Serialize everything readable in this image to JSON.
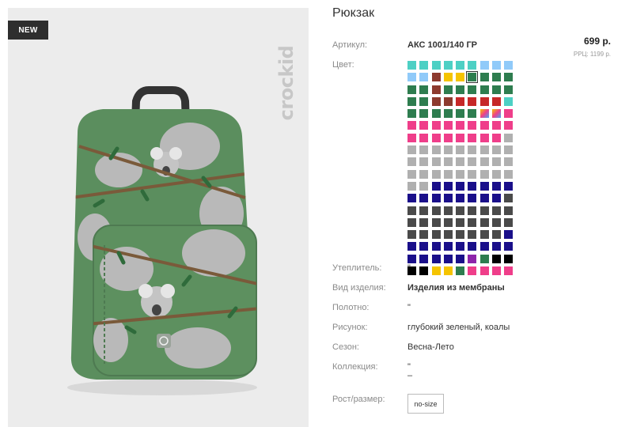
{
  "product": {
    "title": "Рюкзак",
    "badge": "NEW",
    "brand": "crockid",
    "price": "699 р.",
    "rrp": "РРЦ: 1199 р."
  },
  "attributes": {
    "article": {
      "label": "Артикул:",
      "value": "АКС 1001/140 ГР"
    },
    "color": {
      "label": "Цвет:"
    },
    "insulation": {
      "label": "Утеплитель:",
      "value": "\""
    },
    "product_type": {
      "label": "Вид изделия:",
      "value": "Изделия из мембраны"
    },
    "fabric": {
      "label": "Полотно:",
      "value": "\""
    },
    "pattern": {
      "label": "Рисунок:",
      "value": "глубокий зеленый, коалы"
    },
    "season": {
      "label": "Сезон:",
      "value": "Весна-Лето"
    },
    "collection": {
      "label": "Коллекция:",
      "value": "\"",
      "value2": "–"
    },
    "size": {
      "label": "Рост/размер:",
      "option": "no-size"
    }
  },
  "swatches": [
    "#4dd0c4",
    "#4dd0c4",
    "#4dd0c4",
    "#4dd0c4",
    "#4dd0c4",
    "#4dd0c4",
    "#90caf9",
    "#90caf9",
    "#90caf9",
    "#90caf9",
    "#90caf9",
    "#8d3a2e",
    "#f5c400",
    "#f5c400",
    "#2e7d4f",
    "#2e7d4f",
    "#2e7d4f",
    "#2e7d4f",
    "#2e7d4f",
    "#2e7d4f",
    "#8d3a2e",
    "#2e7d4f",
    "#2e7d4f",
    "#2e7d4f",
    "#2e7d4f",
    "#2e7d4f",
    "#2e7d4f",
    "#2e7d4f",
    "#2e7d4f",
    "#8d3a2e",
    "#8d3a2e",
    "#c62828",
    "#c62828",
    "#c62828",
    "#c62828",
    "#4dd0c4",
    "#2e7d4f",
    "#2e7d4f",
    "#2e7d4f",
    "#2e7d4f",
    "#2e7d4f",
    "#2e7d4f",
    "#multi",
    "#multi",
    "#ef3e8a",
    "#ef3e8a",
    "#ef3e8a",
    "#ef3e8a",
    "#ef3e8a",
    "#ef3e8a",
    "#ef3e8a",
    "#ef3e8a",
    "#ef3e8a",
    "#ef3e8a",
    "#ef3e8a",
    "#ef3e8a",
    "#ef3e8a",
    "#ef3e8a",
    "#ef3e8a",
    "#ef3e8a",
    "#ef3e8a",
    "#ef3e8a",
    "#b0b0b0",
    "#b0b0b0",
    "#b0b0b0",
    "#b0b0b0",
    "#b0b0b0",
    "#b0b0b0",
    "#b0b0b0",
    "#b0b0b0",
    "#b0b0b0",
    "#b0b0b0",
    "#b0b0b0",
    "#b0b0b0",
    "#b0b0b0",
    "#b0b0b0",
    "#b0b0b0",
    "#b0b0b0",
    "#b0b0b0",
    "#b0b0b0",
    "#b0b0b0",
    "#b0b0b0",
    "#b0b0b0",
    "#b0b0b0",
    "#b0b0b0",
    "#b0b0b0",
    "#b0b0b0",
    "#b0b0b0",
    "#b0b0b0",
    "#b0b0b0",
    "#b0b0b0",
    "#b0b0b0",
    "#1a0f8a",
    "#1a0f8a",
    "#1a0f8a",
    "#1a0f8a",
    "#1a0f8a",
    "#1a0f8a",
    "#1a0f8a",
    "#1a0f8a",
    "#1a0f8a",
    "#1a0f8a",
    "#1a0f8a",
    "#1a0f8a",
    "#1a0f8a",
    "#1a0f8a",
    "#1a0f8a",
    "#4a4a4a",
    "#4a4a4a",
    "#4a4a4a",
    "#4a4a4a",
    "#4a4a4a",
    "#4a4a4a",
    "#4a4a4a",
    "#4a4a4a",
    "#4a4a4a",
    "#4a4a4a",
    "#4a4a4a",
    "#4a4a4a",
    "#4a4a4a",
    "#4a4a4a",
    "#4a4a4a",
    "#4a4a4a",
    "#4a4a4a",
    "#4a4a4a",
    "#4a4a4a",
    "#4a4a4a",
    "#4a4a4a",
    "#4a4a4a",
    "#4a4a4a",
    "#4a4a4a",
    "#4a4a4a",
    "#4a4a4a",
    "#4a4a4a",
    "#1a0f8a",
    "#1a0f8a",
    "#1a0f8a",
    "#1a0f8a",
    "#1a0f8a",
    "#1a0f8a",
    "#1a0f8a",
    "#1a0f8a",
    "#1a0f8a",
    "#1a0f8a",
    "#1a0f8a",
    "#1a0f8a",
    "#1a0f8a",
    "#1a0f8a",
    "#1a0f8a",
    "#8e24aa",
    "#2e7d4f",
    "#000000",
    "#000000",
    "#000000",
    "#000000",
    "#f5c400",
    "#f5c400",
    "#2e7d4f",
    "#ef3e8a",
    "#ef3e8a",
    "#ef3e8a",
    "#ef3e8a"
  ],
  "selected_swatch": 14,
  "colors": {
    "badge_bg": "#2e2e2e",
    "photo_bg": "#ececec",
    "bag_green": "#5b8e5e",
    "koala_grey": "#b9b9b9"
  }
}
